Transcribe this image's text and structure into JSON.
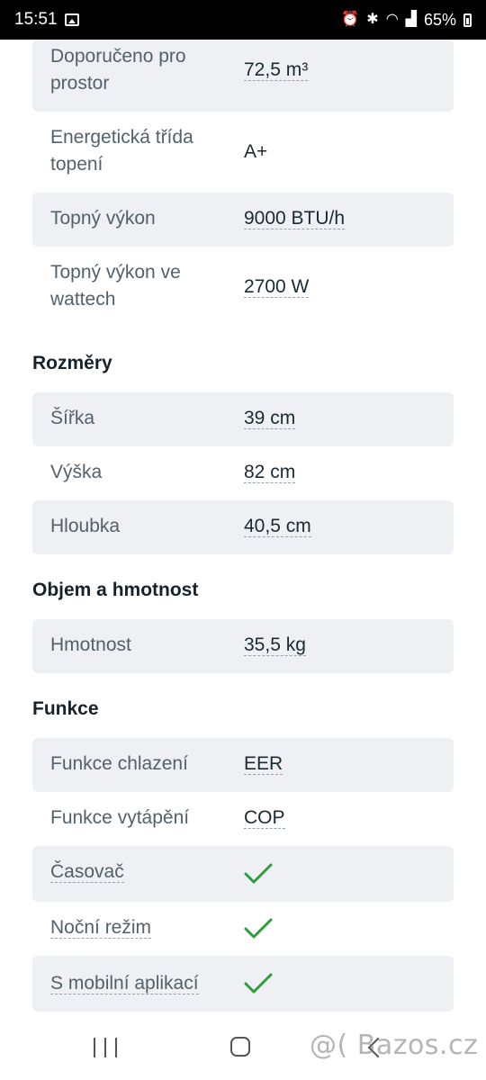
{
  "status_bar": {
    "time": "15:51",
    "battery": "65%",
    "icons": [
      "gallery-icon",
      "alarm-icon",
      "bluetooth-icon",
      "wifi-icon",
      "signal-icon",
      "battery-icon"
    ]
  },
  "sections": {
    "topeni": {
      "rows": [
        {
          "label": "Doporučeno pro prostor",
          "value": "72,5 m³"
        },
        {
          "label": "Energetická třída topení",
          "value": "A+"
        },
        {
          "label": "Topný výkon",
          "value": "9000 BTU/h"
        },
        {
          "label": "Topný výkon ve wattech",
          "value": "2700 W"
        }
      ]
    },
    "rozmery": {
      "title": "Rozměry",
      "rows": [
        {
          "label": "Šířka",
          "value": "39 cm"
        },
        {
          "label": "Výška",
          "value": "82 cm"
        },
        {
          "label": "Hloubka",
          "value": "40,5 cm"
        }
      ]
    },
    "objem": {
      "title": "Objem a hmotnost",
      "rows": [
        {
          "label": "Hmotnost",
          "value": "35,5 kg"
        }
      ]
    },
    "funkce": {
      "title": "Funkce",
      "rows": [
        {
          "label": "Funkce chlazení",
          "value": "EER"
        },
        {
          "label": "Funkce vytápění",
          "value": "COP"
        },
        {
          "label": "Časovač",
          "value": "check-icon"
        },
        {
          "label": "Noční režim",
          "value": "check-icon"
        },
        {
          "label": "S mobilní aplikací",
          "value": "check-icon"
        }
      ]
    }
  },
  "colors": {
    "row_shade": "#eef0f3",
    "label": "#53616b",
    "value": "#1a2a33",
    "check": "#2e9c3e"
  },
  "watermark": "@( Bazos.cz"
}
